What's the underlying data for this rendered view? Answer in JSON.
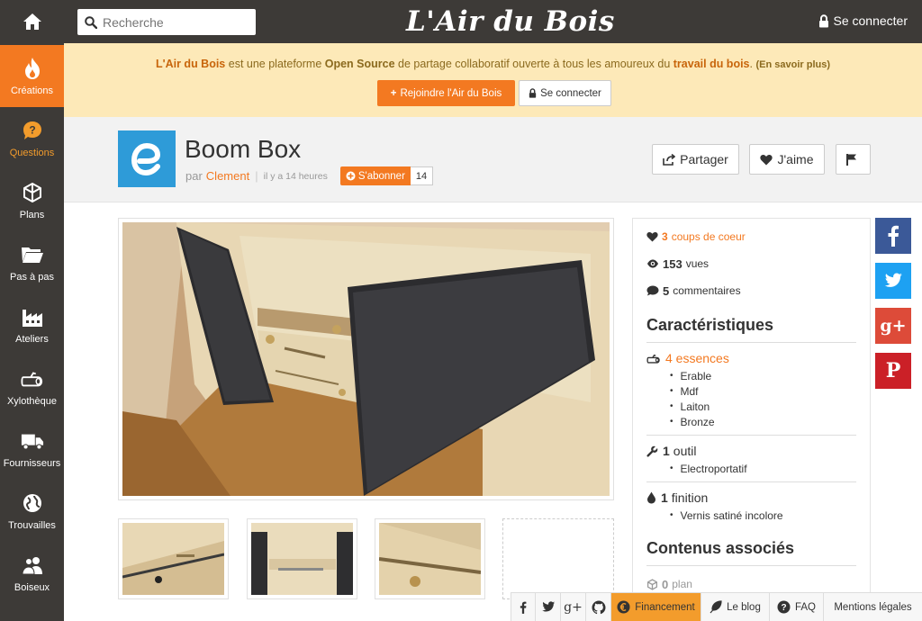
{
  "app": {
    "logo": "L'Air du Bois"
  },
  "search": {
    "placeholder": "Recherche"
  },
  "top_login": "Se connecter",
  "sidebar": [
    {
      "label": "Créations",
      "icon": "flame-icon",
      "active": true
    },
    {
      "label": "Questions",
      "icon": "question-bubble-icon"
    },
    {
      "label": "Plans",
      "icon": "cube-icon"
    },
    {
      "label": "Pas à pas",
      "icon": "folder-icon"
    },
    {
      "label": "Ateliers",
      "icon": "factory-icon"
    },
    {
      "label": "Xylothèque",
      "icon": "wood-log-icon"
    },
    {
      "label": "Fournisseurs",
      "icon": "truck-icon"
    },
    {
      "label": "Trouvailles",
      "icon": "globe-icon"
    },
    {
      "label": "Boiseux",
      "icon": "users-icon"
    }
  ],
  "banner": {
    "brand": "L'Air du Bois",
    "t1": " est une plateforme ",
    "open": "Open Source",
    "t2": " de partage collaboratif ouverte à tous les amoureux du ",
    "wood": "travail du bois",
    "t3": ".",
    "more": "(En savoir plus)",
    "join_btn": "Rejoindre l'Air du Bois",
    "login_btn": "Se connecter"
  },
  "post": {
    "title": "Boom Box",
    "by": "par",
    "author": "Clement",
    "time": "il y a 14 heures",
    "subscribe": "S'abonner",
    "subscribers": "14",
    "share": "Partager",
    "like": "J'aime"
  },
  "stats": {
    "likes_count": "3",
    "likes_label": "coups de coeur",
    "views_count": "153",
    "views_label": "vues",
    "comments_count": "5",
    "comments_label": "commentaires"
  },
  "characteristics": {
    "heading": "Caractéristiques",
    "species_head": "4 essences",
    "species": [
      "Erable",
      "Mdf",
      "Laiton",
      "Bronze"
    ],
    "tools_count": "1",
    "tools_label": "outil",
    "tools": [
      "Electroportatif"
    ],
    "finish_count": "1",
    "finish_label": "finition",
    "finishes": [
      "Vernis satiné incolore"
    ]
  },
  "related": {
    "heading": "Contenus associés",
    "plans_count": "0",
    "plans_label": "plan"
  },
  "social": [
    {
      "name": "facebook",
      "glyph": "f",
      "color": "#3b5998"
    },
    {
      "name": "twitter",
      "glyph": "t",
      "color": "#1da1f2"
    },
    {
      "name": "google-plus",
      "glyph": "g+",
      "color": "#dd4b39"
    },
    {
      "name": "pinterest",
      "glyph": "P",
      "color": "#cb2027"
    }
  ],
  "footer": {
    "financement": "Financement",
    "blog": "Le blog",
    "faq": "FAQ",
    "legal": "Mentions légales"
  }
}
